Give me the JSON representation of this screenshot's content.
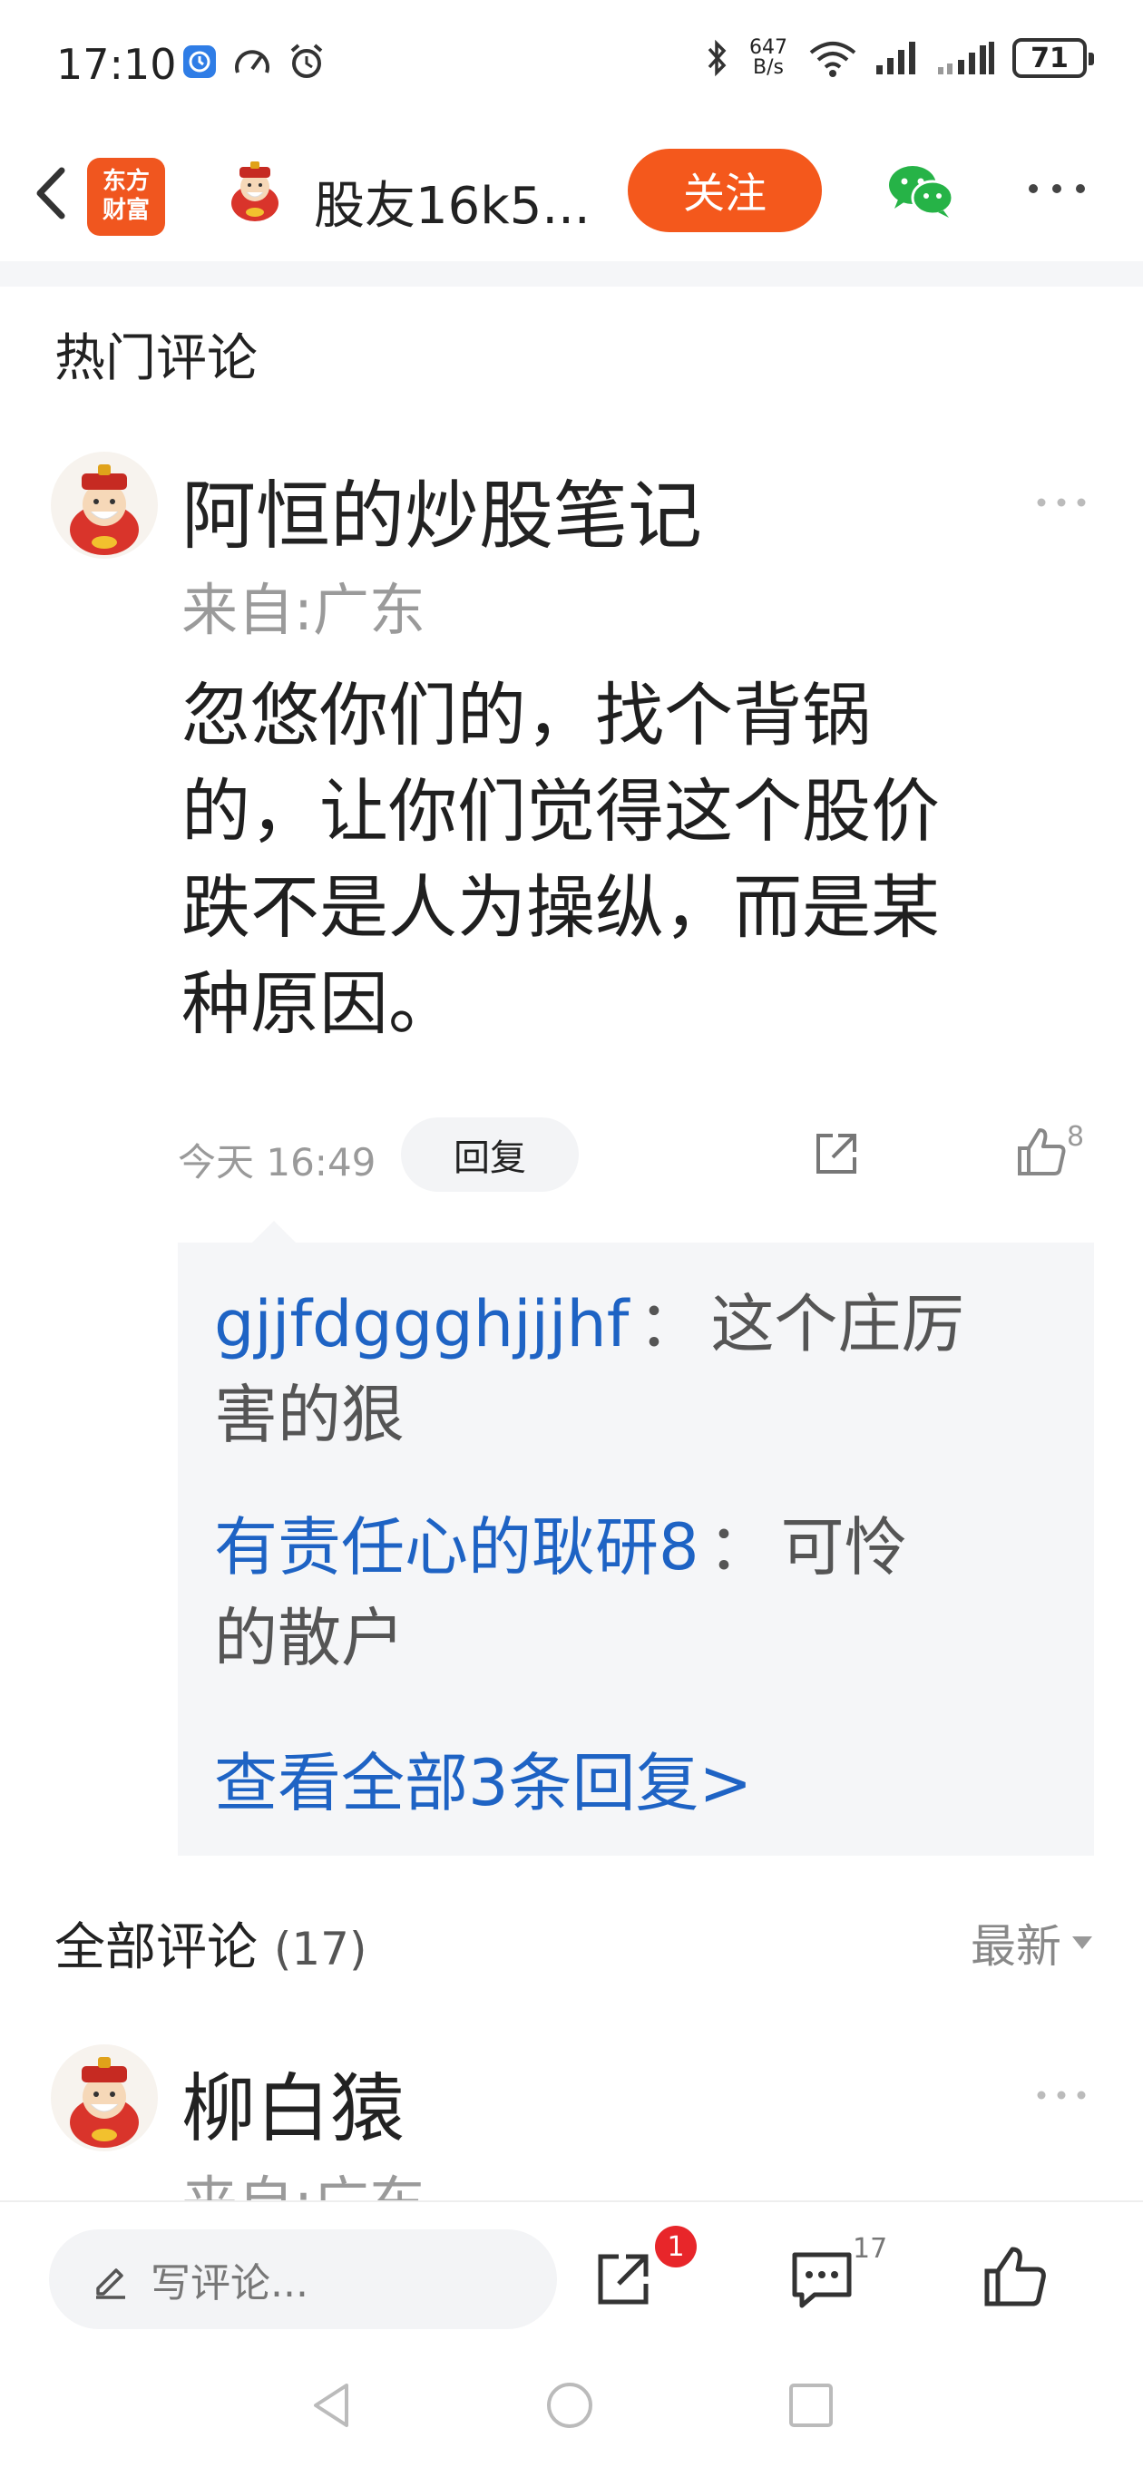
{
  "status_bar": {
    "time": "17:10",
    "net_speed_value": "647",
    "net_speed_unit": "B/s",
    "battery": "71",
    "icons": [
      "clock-app-icon",
      "speedometer-icon",
      "alarm-icon",
      "bluetooth-icon",
      "wifi-icon",
      "signal-icon",
      "signal-icon-2",
      "battery-icon"
    ]
  },
  "nav": {
    "logo_line1": "东方",
    "logo_line2": "财富",
    "author_name": "股友16k5...",
    "follow_label": "关注",
    "icons": [
      "back-icon",
      "wechat-icon",
      "more-icon"
    ]
  },
  "hot": {
    "title": "热门评论",
    "comment": {
      "user": "阿恒的炒股笔记",
      "from": "来自:广东",
      "lines": [
        "忽悠你们的，找个背锅",
        "的，让你们觉得这个股价",
        "跌不是人为操纵，而是某",
        "种原因。"
      ],
      "time": "今天 16:49",
      "reply_label": "回复",
      "like_count": "8",
      "replies": [
        {
          "author": "gjjfdggghjjjhf",
          "sep": "：",
          "line1": "这个庄厉",
          "line2": "害的狠"
        },
        {
          "author": "有责任心的耿研8",
          "sep": "：",
          "line1": "可怜",
          "line2": "的散户"
        }
      ],
      "view_all": "查看全部3条回复>"
    }
  },
  "all": {
    "title": "全部评论",
    "count": "(17)",
    "sort_label": "最新",
    "first": {
      "user": "柳白猿",
      "from": "来自:广东"
    }
  },
  "bottom": {
    "input_placeholder": "写评论...",
    "share_badge": "1",
    "comment_count": "17"
  },
  "colors": {
    "accent": "#f4581c",
    "link": "#1e63c4",
    "badge": "#e8262a",
    "background_gray": "#f5f6f8"
  }
}
